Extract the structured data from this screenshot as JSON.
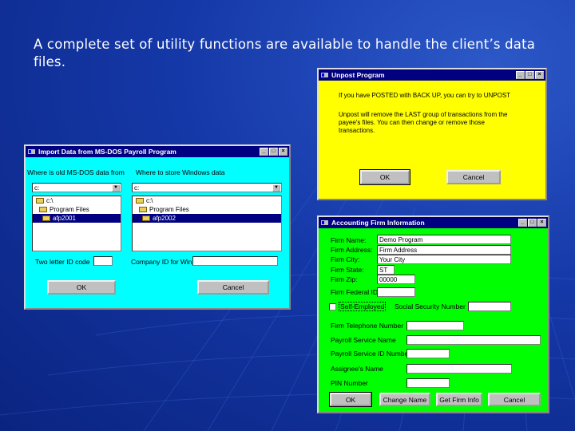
{
  "slide": {
    "text": "A complete set of utility functions are available to handle the client’s data files."
  },
  "colors": {
    "background": "#1538a8",
    "import_window": "#00ffff",
    "unpost_window": "#ffff00",
    "firm_window": "#00ff00",
    "titlebar": "#000080"
  },
  "import_window": {
    "title": "Import Data from MS-DOS Payroll Program",
    "label_from": "Where is old MS-DOS data from",
    "label_to": "Where to store Windows data",
    "drive_left": "c:",
    "drive_right": "c:",
    "tree_left": [
      "c:\\",
      "Program Files",
      "afp2001"
    ],
    "tree_right": [
      "c:\\",
      "Program Files",
      "afp2002"
    ],
    "label_two_letter": "Two letter ID code",
    "label_company": "Company ID for Win",
    "ok_label": "OK",
    "cancel_label": "Cancel"
  },
  "unpost_window": {
    "title": "Unpost Program",
    "line1": "If you have POSTED with BACK UP, you can try to UNPOST",
    "line2": "Unpost will remove the LAST group of transactions from the payee's files. You can then change or remove those transactions.",
    "ok_label": "OK",
    "cancel_label": "Cancel"
  },
  "firm_window": {
    "title": "Accounting Firm Information",
    "fields": [
      {
        "label": "Firm Name:",
        "value": "Demo Program"
      },
      {
        "label": "Firm Address:",
        "value": "Firm Address"
      },
      {
        "label": "Firm City:",
        "value": "Your City"
      },
      {
        "label": "Firm State:",
        "value": "ST"
      },
      {
        "label": "Firm Zip:",
        "value": "00000"
      },
      {
        "label": "Firm Federal ID:",
        "value": ""
      }
    ],
    "self_employed_label": "Self-Employed",
    "ssn_label": "Social Security Number",
    "phone_label": "Firm Telephone Number",
    "svc_name_label": "Payroll Service Name",
    "svc_id_label": "Payroll Service ID Number",
    "assignee_label": "Assignee's Name",
    "pin_label": "PIN Number",
    "ok_label": "OK",
    "change_name_label": "Change Name",
    "get_info_label": "Get Firm Info",
    "cancel_label": "Cancel"
  }
}
